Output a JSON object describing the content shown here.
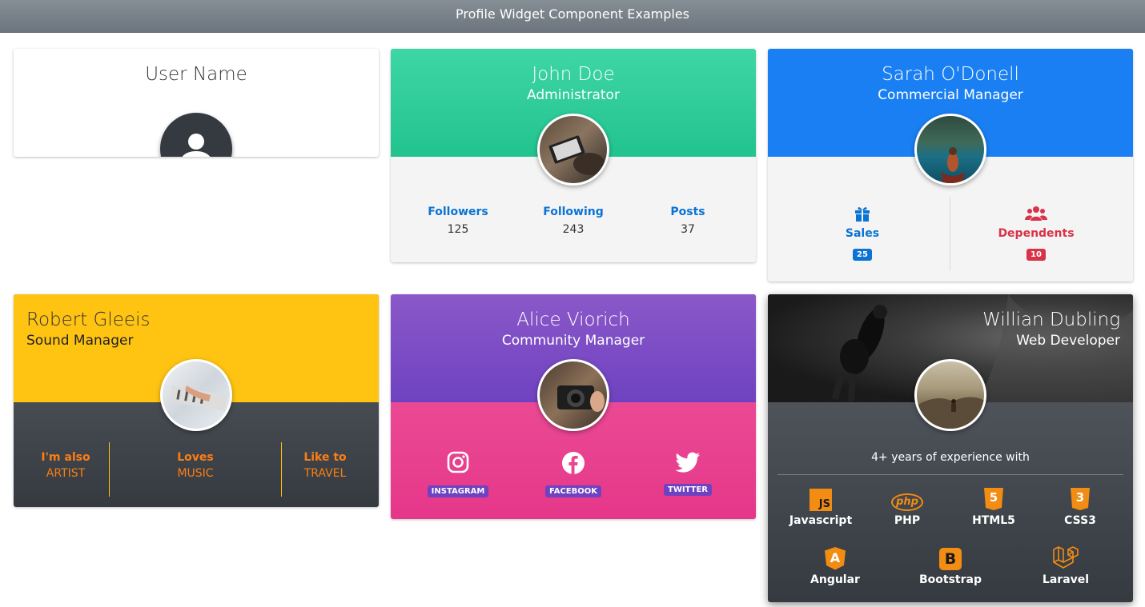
{
  "topbar": {
    "title": "Profile Widget Component Examples"
  },
  "card1": {
    "name": "User Name"
  },
  "card2": {
    "name": "John Doe",
    "role": "Administrator",
    "stats": [
      {
        "label": "Followers",
        "value": "125"
      },
      {
        "label": "Following",
        "value": "243"
      },
      {
        "label": "Posts",
        "value": "37"
      }
    ]
  },
  "card3": {
    "name": "Sarah O'Donell",
    "role": "Commercial Manager",
    "stats": [
      {
        "label": "Sales",
        "badge": "25",
        "color": "#0a73d4",
        "icon": "gift-icon"
      },
      {
        "label": "Dependents",
        "badge": "10",
        "color": "#d9334a",
        "icon": "users-icon"
      }
    ]
  },
  "card4": {
    "name": "Robert Gleeis",
    "role": "Sound Manager",
    "items": [
      {
        "top": "I'm also",
        "bottom": "ARTIST"
      },
      {
        "top": "Loves",
        "bottom": "MUSIC"
      },
      {
        "top": "Like to",
        "bottom": "TRAVEL"
      }
    ]
  },
  "card5": {
    "name": "Alice Viorich",
    "role": "Community Manager",
    "socials": [
      {
        "label": "INSTAGRAM",
        "icon": "instagram-icon"
      },
      {
        "label": "FACEBOOK",
        "icon": "facebook-icon"
      },
      {
        "label": "TWITTER",
        "icon": "twitter-icon"
      }
    ]
  },
  "card6": {
    "name": "Willian Dubling",
    "role": "Web Developer",
    "experience": "4+ years of experience with",
    "tech_row1": [
      "Javascript",
      "PHP",
      "HTML5",
      "CSS3"
    ],
    "tech_row2": [
      "Angular",
      "Bootstrap",
      "Laravel"
    ],
    "js_logo": "JS",
    "php_logo": "php",
    "html_logo": "5",
    "css_logo": "3",
    "angular_logo": "A",
    "bootstrap_logo": "B"
  }
}
